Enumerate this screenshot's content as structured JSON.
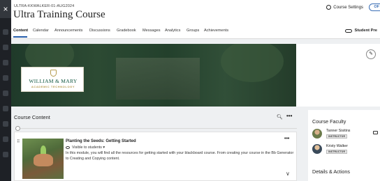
{
  "header": {
    "course_code": "ULTRA-KKWALKER-01-AUG2024",
    "course_title": "Ultra Training Course",
    "settings_label": "Course Settings",
    "status_pill": "OF"
  },
  "close_label": "×",
  "nav": {
    "items": [
      "Content",
      "Calendar",
      "Announcements",
      "Discussions",
      "Gradebook",
      "Messages",
      "Analytics",
      "Groups",
      "Achievements"
    ],
    "active": "Content",
    "student_preview": "Student Pre"
  },
  "banner": {
    "logo_name": "WILLIAM & MARY",
    "logo_sub": "ACADEMIC TECHNOLOGY"
  },
  "content": {
    "title": "Course Content",
    "search_icon": "search-icon",
    "more_label": "•••",
    "modules": [
      {
        "title": "Planting the Seeds: Getting Started",
        "visibility": "Visible to students ▾",
        "description": "In this module, you will find all the resources for getting started with your blackboard course. From creating your course in the Bb Generator to Creating and Copying content."
      }
    ]
  },
  "faculty": {
    "title": "Course Faculty",
    "people": [
      {
        "name": "Tanner Sisitins",
        "role": "INSTRUCTOR"
      },
      {
        "name": "Kristy Walker",
        "role": "INSTRUCTOR"
      }
    ],
    "details_title": "Details & Actions"
  },
  "colors": {
    "accent": "#265dab",
    "wm_green": "#115740",
    "wm_gold": "#b59b4d"
  }
}
